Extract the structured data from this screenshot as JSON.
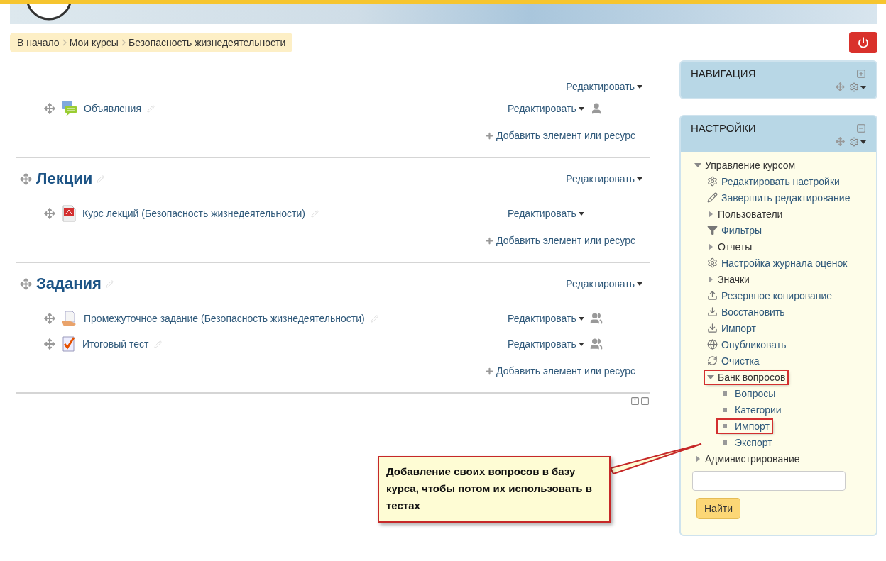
{
  "breadcrumb": [
    {
      "label": "В начало"
    },
    {
      "label": "Мои курсы"
    },
    {
      "label": "Безопасность жизнедеятельности"
    }
  ],
  "sections": [
    {
      "edit": "Редактировать",
      "items": [
        {
          "title": "Объявления",
          "kind": "forum",
          "edit": "Редактировать"
        }
      ],
      "add": "Добавить элемент или ресурс"
    },
    {
      "title": "Лекции",
      "edit": "Редактировать",
      "items": [
        {
          "title": "Курс лекций (Безопасность жизнедеятельности)",
          "kind": "pdf",
          "edit": "Редактировать"
        }
      ],
      "add": "Добавить элемент или ресурс"
    },
    {
      "title": "Задания",
      "edit": "Редактировать",
      "items": [
        {
          "title": "Промежуточное задание (Безопасность жизнедеятельности)",
          "kind": "assignment",
          "edit": "Редактировать"
        },
        {
          "title": "Итоговый тест",
          "kind": "quiz",
          "edit": "Редактировать"
        }
      ],
      "add": "Добавить элемент или ресурс"
    }
  ],
  "navigation": {
    "title": "НАВИГАЦИЯ",
    "docked": true
  },
  "settings": {
    "title": "НАСТРОЙКИ",
    "docked": false,
    "tree": [
      {
        "label": "Управление курсом",
        "kind": "branch",
        "expanded": true,
        "highlighted": false,
        "children": [
          {
            "label": "Редактировать настройки",
            "kind": "gear",
            "highlighted": false
          },
          {
            "label": "Завершить редактирование",
            "kind": "pencil",
            "highlighted": false
          },
          {
            "label": "Пользователи",
            "kind": "branch",
            "expanded": false,
            "highlighted": false
          },
          {
            "label": "Фильтры",
            "kind": "filter",
            "highlighted": false
          },
          {
            "label": "Отчеты",
            "kind": "branch",
            "expanded": false,
            "highlighted": false
          },
          {
            "label": "Настройка журнала оценок",
            "kind": "gear",
            "highlighted": false
          },
          {
            "label": "Значки",
            "kind": "branch",
            "expanded": false,
            "highlighted": false
          },
          {
            "label": "Резервное копирование",
            "kind": "upload",
            "highlighted": false
          },
          {
            "label": "Восстановить",
            "kind": "download",
            "highlighted": false
          },
          {
            "label": "Импорт",
            "kind": "download",
            "highlighted": false
          },
          {
            "label": "Опубликовать",
            "kind": "globe",
            "highlighted": false
          },
          {
            "label": "Очистка",
            "kind": "refresh",
            "highlighted": false
          },
          {
            "label": "Банк вопросов",
            "kind": "branch",
            "expanded": true,
            "highlighted": true,
            "children": [
              {
                "label": "Вопросы",
                "kind": "bullet",
                "highlighted": false
              },
              {
                "label": "Категории",
                "kind": "bullet",
                "highlighted": false
              },
              {
                "label": "Импорт",
                "kind": "bullet",
                "highlighted": true
              },
              {
                "label": "Экспорт",
                "kind": "bullet",
                "highlighted": false
              }
            ]
          }
        ]
      },
      {
        "label": "Администрирование",
        "kind": "branch",
        "expanded": false,
        "highlighted": false
      }
    ],
    "search_button": "Найти"
  },
  "callout": {
    "text": "Добавление своих вопросов в базу курса, чтобы потом их использовать в тестах"
  }
}
